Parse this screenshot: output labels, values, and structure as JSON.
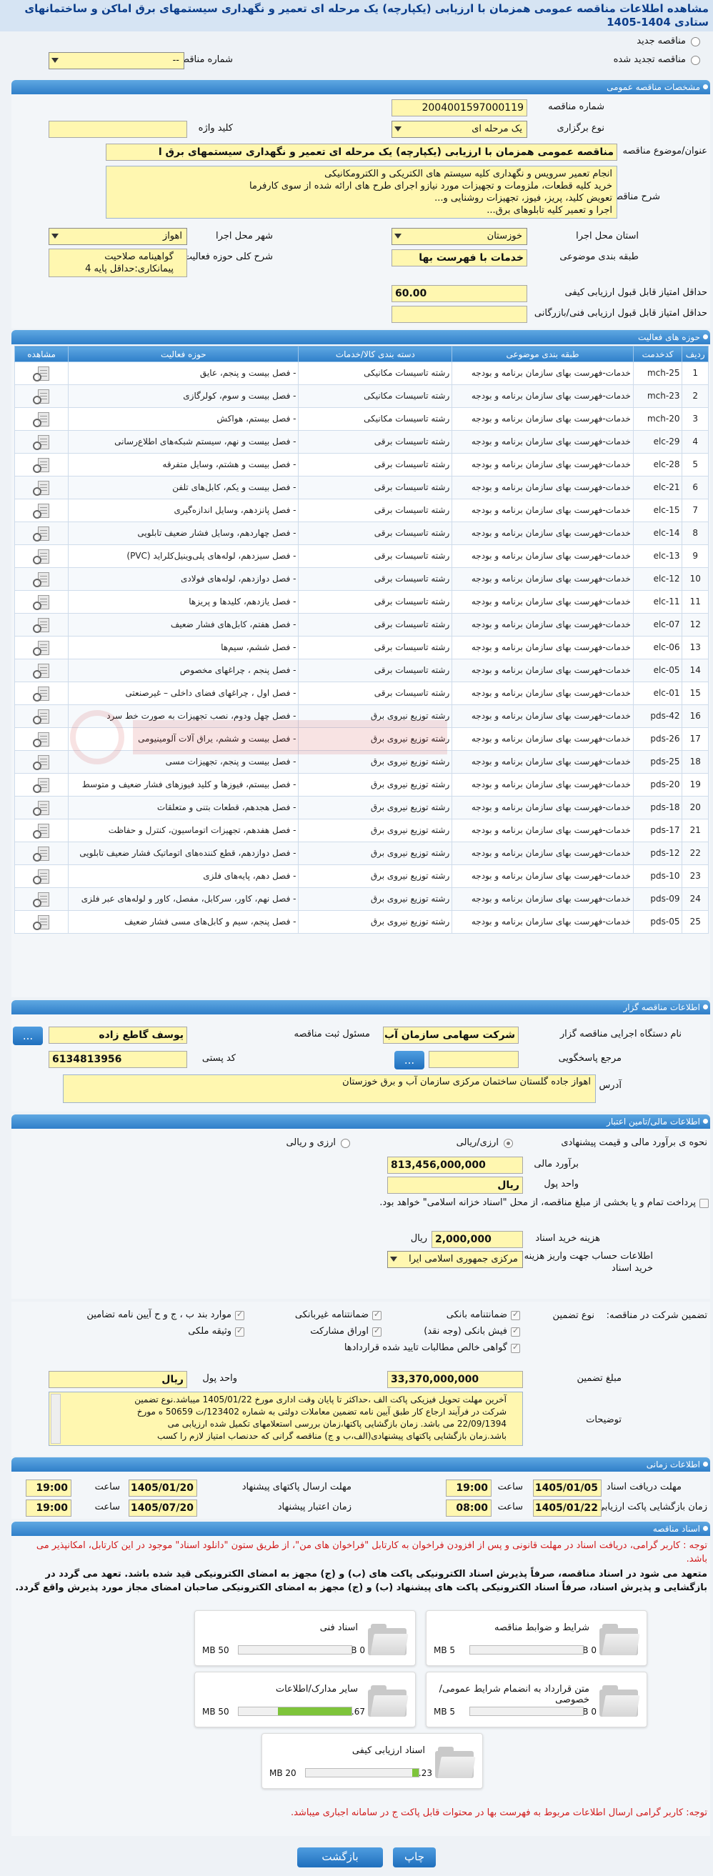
{
  "page_title": "مشاهده اطلاعات مناقصه عمومی همزمان با ارزیابی (یکپارچه) یک مرحله ای تعمیر و نگهداری سیستمهای برق اماکن و ساختمانهای ستادی 1404-1405",
  "top": {
    "new_label": "مناقصه جدید",
    "renewed_label": "مناقصه تجدید شده",
    "prev_label": "شماره مناقصه قبلی",
    "prev_value": "--"
  },
  "general": {
    "header": "مشخصات مناقصه عمومی",
    "number_label": "شماره مناقصه",
    "number_value": "2004001597000119",
    "type_label": "نوع برگزاری",
    "type_value": "یک مرحله ای",
    "keyword_label": "کلید واژه",
    "keyword_value": "",
    "subject_label": "عنوان/موضوع مناقصه",
    "subject_value": "مناقصه عمومی همزمان با ارزیابی (یکپارچه) یک مرحله ای تعمیر و نگهداری سیستمهای برق ا",
    "desc_label": "شرح مناقصه",
    "desc_lines": [
      "انجام تعمیر سرویس و نگهداری کلیه سیستم های الکتریکی و الکترومکانیکی",
      "خرید کلیه قطعات، ملزومات و تجهیزات مورد نیازو اجرای طرح های ارائه شده از سوی کارفرما",
      "تعویض کلید، پریز، فیوز، تجهیزات روشنایی و...",
      "اجرا و تعمیر کلیه تابلوهای برق..."
    ],
    "province_label": "استان محل اجرا",
    "province_value": "خوزستان",
    "city_label": "شهر محل اجرا",
    "city_value": "اهواز",
    "category_label": "طبقه بندی موضوعی",
    "category_value": "خدمات با فهرست بها",
    "scope_label": "شرح کلی حوزه فعالیت",
    "scope_lines": [
      "گواهینامه صلاحیت",
      "پیمانکاری:حداقل پایه 4"
    ],
    "min_quality_label": "حداقل امتیاز قابل قبول ارزیابی کیفی",
    "min_quality_value": "60.00",
    "min_tech_label": "حداقل امتیاز قابل قبول ارزیابی فنی/بازرگانی",
    "min_tech_value": ""
  },
  "activity": {
    "header": "حوزه های فعالیت",
    "columns": [
      "ردیف",
      "کدخدمت",
      "طبقه بندی موضوعی",
      "دسته بندی کالا/خدمات",
      "حوزه فعالیت",
      "مشاهده"
    ],
    "rows": [
      [
        "1",
        "mch-25",
        "خدمات-فهرست بهای سازمان برنامه و بودجه",
        "رشته تاسیسات مکانیکی",
        "- فصل بیست و پنجم، عایق"
      ],
      [
        "2",
        "mch-23",
        "خدمات-فهرست بهای سازمان برنامه و بودجه",
        "رشته تاسیسات مکانیکی",
        "- فصل بیست و سوم، کولرگازی"
      ],
      [
        "3",
        "mch-20",
        "خدمات-فهرست بهای سازمان برنامه و بودجه",
        "رشته تاسیسات مکانیکی",
        "- فصل بیستم، هواکش"
      ],
      [
        "4",
        "elc-29",
        "خدمات-فهرست بهای سازمان برنامه و بودجه",
        "رشته تاسیسات برقی",
        "- فصل بیست و نهم، سیستم شبکه‌های اطلاع‌رسانی"
      ],
      [
        "5",
        "elc-28",
        "خدمات-فهرست بهای سازمان برنامه و بودجه",
        "رشته تاسیسات برقی",
        "- فصل بیست و هشتم، وسایل متفرقه"
      ],
      [
        "6",
        "elc-21",
        "خدمات-فهرست بهای سازمان برنامه و بودجه",
        "رشته تاسیسات برقی",
        "- فصل بیست و یکم، کابل‌های تلفن"
      ],
      [
        "7",
        "elc-15",
        "خدمات-فهرست بهای سازمان برنامه و بودجه",
        "رشته تاسیسات برقی",
        "- فصل پانزدهم، وسایل اندازه‌گیری"
      ],
      [
        "8",
        "elc-14",
        "خدمات-فهرست بهای سازمان برنامه و بودجه",
        "رشته تاسیسات برقی",
        "- فصل چهاردهم، وسایل فشار ضعیف تابلویی"
      ],
      [
        "9",
        "elc-13",
        "خدمات-فهرست بهای سازمان برنامه و بودجه",
        "رشته تاسیسات برقی",
        "- فصل سیزدهم، لوله‌های پلی‌وینیل‌کلراید (PVC)"
      ],
      [
        "10",
        "elc-12",
        "خدمات-فهرست بهای سازمان برنامه و بودجه",
        "رشته تاسیسات برقی",
        "- فصل دوازدهم، لوله‌های فولادی"
      ],
      [
        "11",
        "elc-11",
        "خدمات-فهرست بهای سازمان برنامه و بودجه",
        "رشته تاسیسات برقی",
        "- فصل یازدهم، کلیدها و پریزها"
      ],
      [
        "12",
        "elc-07",
        "خدمات-فهرست بهای سازمان برنامه و بودجه",
        "رشته تاسیسات برقی",
        "- فصل هفتم، کابل‌های فشار ضعیف"
      ],
      [
        "13",
        "elc-06",
        "خدمات-فهرست بهای سازمان برنامه و بودجه",
        "رشته تاسیسات برقی",
        "- فصل ششم، سیم‌ها"
      ],
      [
        "14",
        "elc-05",
        "خدمات-فهرست بهای سازمان برنامه و بودجه",
        "رشته تاسیسات برقی",
        "- فصل پنجم ، چراغهای مخصوص"
      ],
      [
        "15",
        "elc-01",
        "خدمات-فهرست بهای سازمان برنامه و بودجه",
        "رشته تاسیسات برقی",
        "- فصل اول ، چراغهای فضای داخلی – غیرصنعتی"
      ],
      [
        "16",
        "pds-42",
        "خدمات-فهرست بهای سازمان برنامه و بودجه",
        "رشته توزیع نیروی برق",
        "- فصل چهل ودوم، نصب تجهیزات به صورت خط سرد"
      ],
      [
        "17",
        "pds-26",
        "خدمات-فهرست بهای سازمان برنامه و بودجه",
        "رشته توزیع نیروی برق",
        "- فصل بیست و ششم، یراق آلات آلومینیومی"
      ],
      [
        "18",
        "pds-25",
        "خدمات-فهرست بهای سازمان برنامه و بودجه",
        "رشته توزیع نیروی برق",
        "- فصل بیست و پنجم، تجهیزات مسی"
      ],
      [
        "19",
        "pds-20",
        "خدمات-فهرست بهای سازمان برنامه و بودجه",
        "رشته توزیع نیروی برق",
        "- فصل بیستم، فیوزها و کلید فیوزهای فشار ضعیف و متوسط"
      ],
      [
        "20",
        "pds-18",
        "خدمات-فهرست بهای سازمان برنامه و بودجه",
        "رشته توزیع نیروی برق",
        "- فصل هجدهم، قطعات بتنی و متعلقات"
      ],
      [
        "21",
        "pds-17",
        "خدمات-فهرست بهای سازمان برنامه و بودجه",
        "رشته توزیع نیروی برق",
        "- فصل هفدهم، تجهیزات اتوماسیون، کنترل و حفاظت"
      ],
      [
        "22",
        "pds-12",
        "خدمات-فهرست بهای سازمان برنامه و بودجه",
        "رشته توزیع نیروی برق",
        "- فصل دوازدهم، قطع کننده‌های اتوماتیک فشار ضعیف تابلویی"
      ],
      [
        "23",
        "pds-10",
        "خدمات-فهرست بهای سازمان برنامه و بودجه",
        "رشته توزیع نیروی برق",
        "- فصل دهم، پایه‌های فلزی"
      ],
      [
        "24",
        "pds-09",
        "خدمات-فهرست بهای سازمان برنامه و بودجه",
        "رشته توزیع نیروی برق",
        "- فصل نهم، کاور، سرکابل، مفصل، کاور و لوله‌های عبر فلزی"
      ],
      [
        "25",
        "pds-05",
        "خدمات-فهرست بهای سازمان برنامه و بودجه",
        "رشته توزیع نیروی برق",
        "- فصل پنجم، سیم و کابل‌های مسی فشار ضعیف"
      ]
    ]
  },
  "org": {
    "header": "اطلاعات مناقصه گزار",
    "org_label": "نام دستگاه اجرایی مناقصه گزار",
    "org_value": "شرکت سهامی سازمان آب",
    "resp_label": "مسئول ثبت مناقصه",
    "resp_value": "یوسف گاطع زاده",
    "ref_label": "مرجع پاسخگویی",
    "ref_value": "",
    "postal_label": "کد پستی",
    "postal_value": "6134813956",
    "address_label": "آدرس",
    "address_value": "اهواز جاده گلستان ساختمان مرکزی سازمان آب و برق خوزستان",
    "more_btn": "..."
  },
  "finance": {
    "header": "اطلاعات مالی/تامین اعتبار",
    "method_label": "نحوه ی برآورد مالی و قیمت پیشنهادی",
    "opt1": "ارزی/ریالی",
    "opt2": "ارزی و ریالی",
    "estimate_label": "برآورد مالی",
    "estimate_value": "813,456,000,000",
    "unit_label": "واحد پول",
    "unit_value": "ریال",
    "treasury_text": "پرداخت تمام و یا بخشی از مبلغ مناقصه، از محل \"اسناد خزانه اسلامی\" خواهد بود.",
    "doc_fee_label": "هزینه خرید اسناد",
    "doc_fee_value": "2,000,000",
    "doc_fee_unit": "ریال",
    "acct_label": "اطلاعات حساب جهت واریز هزینه خرید اسناد",
    "acct_value": "مرکزی جمهوری اسلامی ایرا"
  },
  "guarantee": {
    "participation_label": "تضمین شرکت در مناقصه:",
    "type_label": "نوع تضمین",
    "opts": [
      "ضمانتنامه بانکی",
      "ضمانتنامه غیربانکی",
      "موارد بند ب ، ج و ح آیین نامه تضامین",
      "فیش بانکی (وجه نقد)",
      "اوراق مشارکت",
      "وثیقه ملکی",
      "گواهی خالص مطالبات تایید شده قراردادها"
    ],
    "amount_label": "مبلغ تضمین",
    "amount_value": "33,370,000,000",
    "unit_label": "واحد پول",
    "unit_value": "ریال",
    "notes_label": "توضیحات",
    "notes_lines": [
      "آخرین مهلت تحویل فیزیکی پاکت الف ،حداکثر تا پایان وقت اداری مورخ 1405/01/22 میباشد.نوع تضمین",
      "شرکت در فرآیند ارجاع کار طبق آیین نامه تضمین معاملات دولتی به شماره 123402/ت 50659 ه مورخ",
      "22/09/1394 می باشد. زمان بازگشایی پاکتها،زمان بررسی استعلامهای تکمیل شده ارزیابی می",
      "باشد.زمان بازگشایی پاکتهای پیشنهادی(الف،ب و ج) مناقصه گرانی که حدنصاب امتیاز لازم را کسب"
    ]
  },
  "timing": {
    "header": "اطلاعات زمانی",
    "recv_label": "مهلت دریافت اسناد",
    "recv_date": "1405/01/05",
    "recv_time": "19:00",
    "send_label": "مهلت ارسال پاکتهای پیشنهاد",
    "send_date": "1405/01/20",
    "send_time": "19:00",
    "open_label": "زمان بازگشایی پاکت ارزیابی کیفی",
    "open_date": "1405/01/22",
    "open_time": "08:00",
    "valid_label": "زمان اعتبار پیشنهاد",
    "valid_date": "1405/07/20",
    "valid_time": "19:00",
    "time_label": "ساعت"
  },
  "docs": {
    "header": "اسناد مناقصه",
    "note1": "توجه : کاربر گرامی، دریافت اسناد در مهلت قانونی و پس از افزودن فراخوان به کارتابل \"فراخوان های من\"، از طریق ستون \"دانلود اسناد\" موجود در این کارتابل، امکانپذیر می باشد.",
    "note2": "متعهد می شود در اسناد مناقصه، صرفاً پذیرش اسناد الکترونیکی پاکت های (ب) و (ج) مجهز به امضای الکترونیکی قید شده باشد. تعهد می گردد در بازگشایی و پذیرش اسناد، صرفاً اسناد الکترونیکی پاکت های پیشنهاد (ب) و (ج) مجهز به امضای الکترونیکی صاحبان امضای مجاز مورد پذیرش واقع گردد.",
    "files": [
      {
        "title": "شرایط و ضوابط مناقصه",
        "used": "5 MB",
        "max": "0 MB",
        "fill": 0
      },
      {
        "title": "اسناد فنی",
        "used": "50 MB",
        "max": "0 MB",
        "fill": 0
      },
      {
        "title": "متن قرارداد به انضمام شرایط عمومی/خصوصی",
        "used": "5 MB",
        "max": "0 MB",
        "fill": 0
      },
      {
        "title": "سایر مدارک/اطلاعات",
        "used": "50 MB",
        "max": "32.67 MB",
        "fill": 0.65
      },
      {
        "title": "اسناد ارزیابی کیفی",
        "used": "20 MB",
        "max": "1.23 MB",
        "fill": 0.06
      }
    ],
    "note3": "توجه: کاربر گرامی ارسال اطلاعات مربوط به فهرست بها در محتوات قابل پاکت ج در سامانه اجباری میباشد."
  },
  "buttons": {
    "print": "چاپ",
    "back": "بازگشت"
  },
  "colors": {
    "header": "#2f7fc9",
    "field": "#fff7b0",
    "red": "#d11a1a",
    "progress": "#7ec43a"
  }
}
